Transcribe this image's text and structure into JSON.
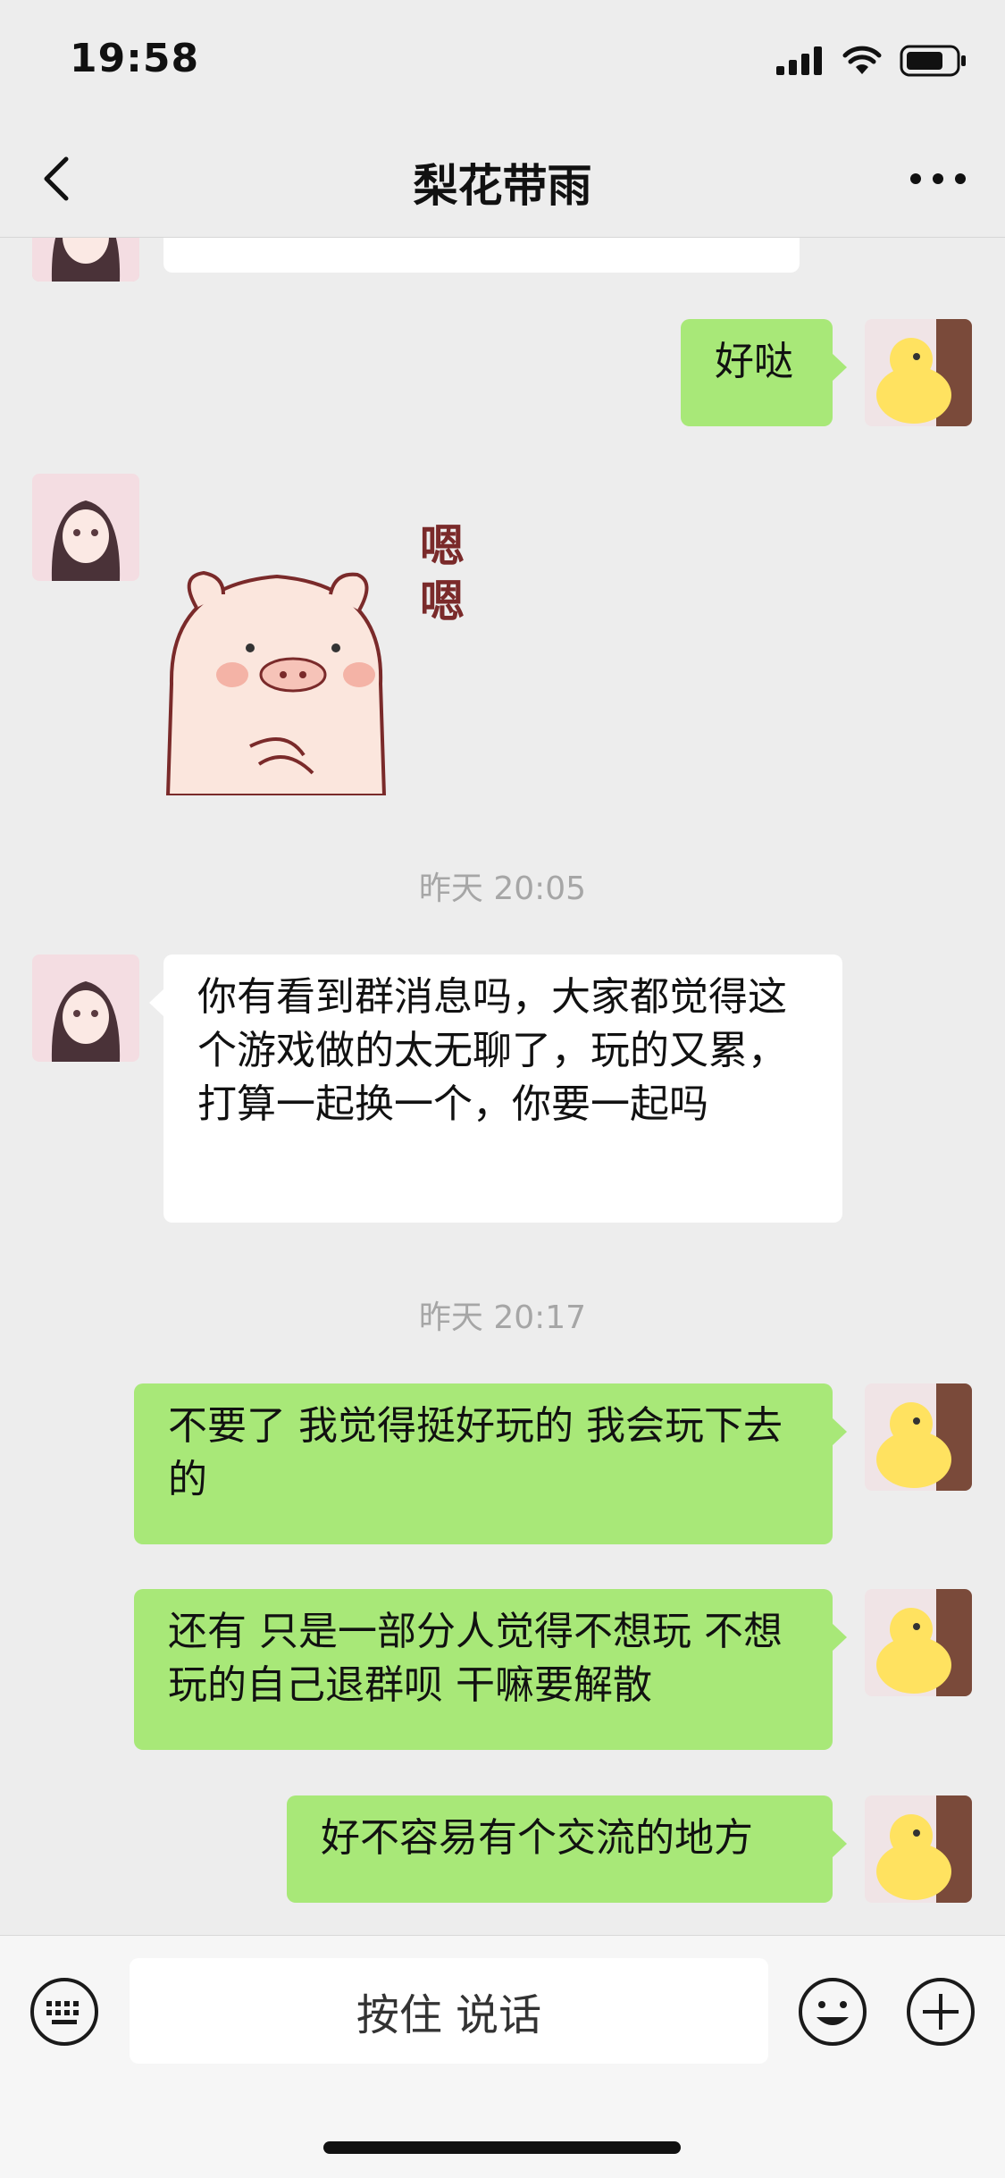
{
  "status_bar": {
    "time": "19:58"
  },
  "header": {
    "title": "梨花带雨"
  },
  "messages": {
    "m1": {
      "text": "好哒"
    },
    "ts1": {
      "text": "昨天 20:05"
    },
    "m2": {
      "text": "你有看到群消息吗，大家都觉得这个游戏做的太无聊了，玩的又累，打算一起换一个，你要一起吗"
    },
    "ts2": {
      "text": "昨天 20:17"
    },
    "m3": {
      "text": "不要了 我觉得挺好玩的 我会玩下去的"
    },
    "m4": {
      "text": "还有 只是一部分人觉得不想玩 不想玩的自己退群呗 干嘛要解散"
    },
    "m5": {
      "text": "好不容易有个交流的地方"
    }
  },
  "sticker": {
    "text": "嗯嗯"
  },
  "input_bar": {
    "voice_label": "按住 说话"
  },
  "colors": {
    "outgoing_bubble": "#a8e878",
    "incoming_bubble": "#ffffff",
    "background": "#ededed"
  }
}
